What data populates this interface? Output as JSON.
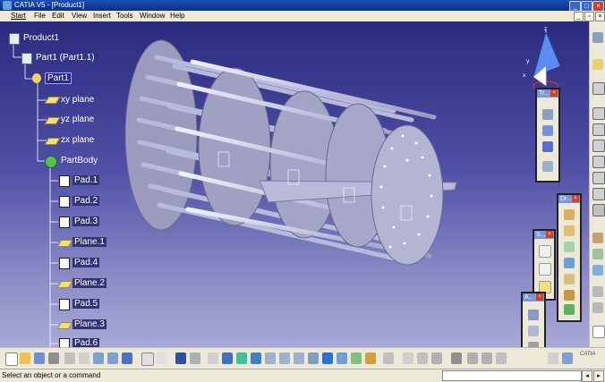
{
  "window": {
    "title": "CATIA V5 - [Product1]"
  },
  "menu": [
    "Start",
    "File",
    "Edit",
    "View",
    "Insert",
    "Tools",
    "Window",
    "Help"
  ],
  "tree": [
    {
      "label": "Product1",
      "icon": "product-icon"
    },
    {
      "label": "Part1 (Part1.1)",
      "icon": "part-instance-icon"
    },
    {
      "label": "Part1",
      "icon": "part-icon"
    },
    {
      "label": "xy plane",
      "icon": "plane-icon"
    },
    {
      "label": "yz plane",
      "icon": "plane-icon"
    },
    {
      "label": "zx plane",
      "icon": "plane-icon"
    },
    {
      "label": "PartBody",
      "icon": "gear-icon"
    },
    {
      "label": "Pad.1",
      "icon": "pad-icon"
    },
    {
      "label": "Pad.2",
      "icon": "pad-icon"
    },
    {
      "label": "Pad.3",
      "icon": "pad-icon"
    },
    {
      "label": "Plane.1",
      "icon": "plane-icon"
    },
    {
      "label": "Pad.4",
      "icon": "pad-icon"
    },
    {
      "label": "Plane.2",
      "icon": "plane-icon"
    },
    {
      "label": "Pad.5",
      "icon": "pad-icon"
    },
    {
      "label": "Plane.3",
      "icon": "plane-icon"
    },
    {
      "label": "Pad.6",
      "icon": "pad-icon"
    }
  ],
  "palettes": {
    "p1": "Tr...",
    "p2": "Dr...",
    "p3": "S...",
    "p4": "A..."
  },
  "status": {
    "text": "Select an object or a command",
    "input_value": ""
  },
  "logo": "CATIA",
  "colors": {
    "viewport_top": "#2a2a7e",
    "viewport_bottom": "#a9a9d6",
    "selection": "#2a2a8c"
  }
}
